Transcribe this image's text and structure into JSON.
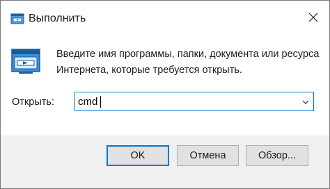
{
  "window": {
    "title": "Выполнить",
    "icon": "run-dialog-icon"
  },
  "body": {
    "icon": "run-program-icon",
    "description": "Введите имя программы, папки, документа или ресурса Интернета, которые требуется открыть.",
    "open_label": "Открыть:",
    "command_value": "cmd"
  },
  "buttons": {
    "ok": "OK",
    "cancel": "Отмена",
    "browse": "Обзор..."
  },
  "colors": {
    "accent": "#0078d7",
    "title_bg": "#ffffff",
    "footer_bg": "#f0f0f0",
    "button_bg": "#e1e1e1"
  }
}
